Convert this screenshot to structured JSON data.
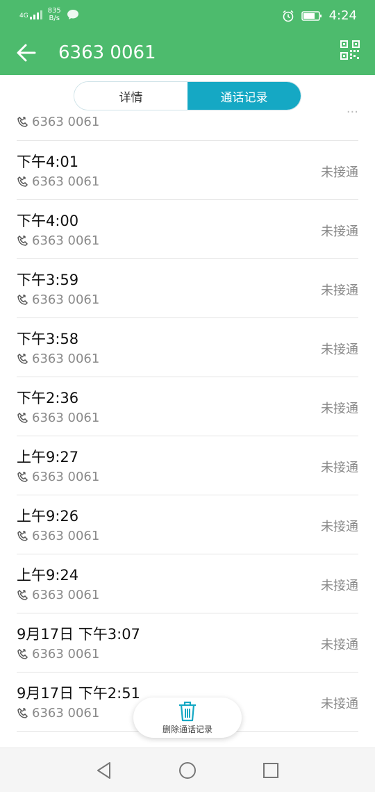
{
  "status_bar": {
    "network": "4G",
    "speed_value": "835",
    "speed_unit": "B/s",
    "time": "4:24"
  },
  "app_bar": {
    "title": "6363 0061",
    "icons": [
      "back-arrow-icon",
      "qr-code-icon"
    ]
  },
  "tabs": [
    {
      "label": "详情",
      "active": false
    },
    {
      "label": "通话记录",
      "active": true
    }
  ],
  "partial_row": {
    "number": "6363 0061"
  },
  "calls": [
    {
      "time": "下午4:01",
      "number": "6363 0061",
      "status": "未接通"
    },
    {
      "time": "下午4:00",
      "number": "6363 0061",
      "status": "未接通"
    },
    {
      "time": "下午3:59",
      "number": "6363 0061",
      "status": "未接通"
    },
    {
      "time": "下午3:58",
      "number": "6363 0061",
      "status": "未接通"
    },
    {
      "time": "下午2:36",
      "number": "6363 0061",
      "status": "未接通"
    },
    {
      "time": "上午9:27",
      "number": "6363 0061",
      "status": "未接通"
    },
    {
      "time": "上午9:26",
      "number": "6363 0061",
      "status": "未接通"
    },
    {
      "time": "上午9:24",
      "number": "6363 0061",
      "status": "未接通"
    },
    {
      "time": "9月17日 下午3:07",
      "number": "6363 0061",
      "status": "未接通"
    },
    {
      "time": "9月17日 下午2:51",
      "number": "6363 0061",
      "status": "未接通"
    }
  ],
  "delete_button": {
    "label": "删除通话记录",
    "icon": "trash-icon"
  },
  "nav_bar": {
    "icons": [
      "back-triangle-icon",
      "home-circle-icon",
      "recents-square-icon"
    ]
  },
  "colors": {
    "accent_green": "#4dbb6d",
    "tab_active": "#15a8c4",
    "trash_icon": "#15a8c4"
  }
}
